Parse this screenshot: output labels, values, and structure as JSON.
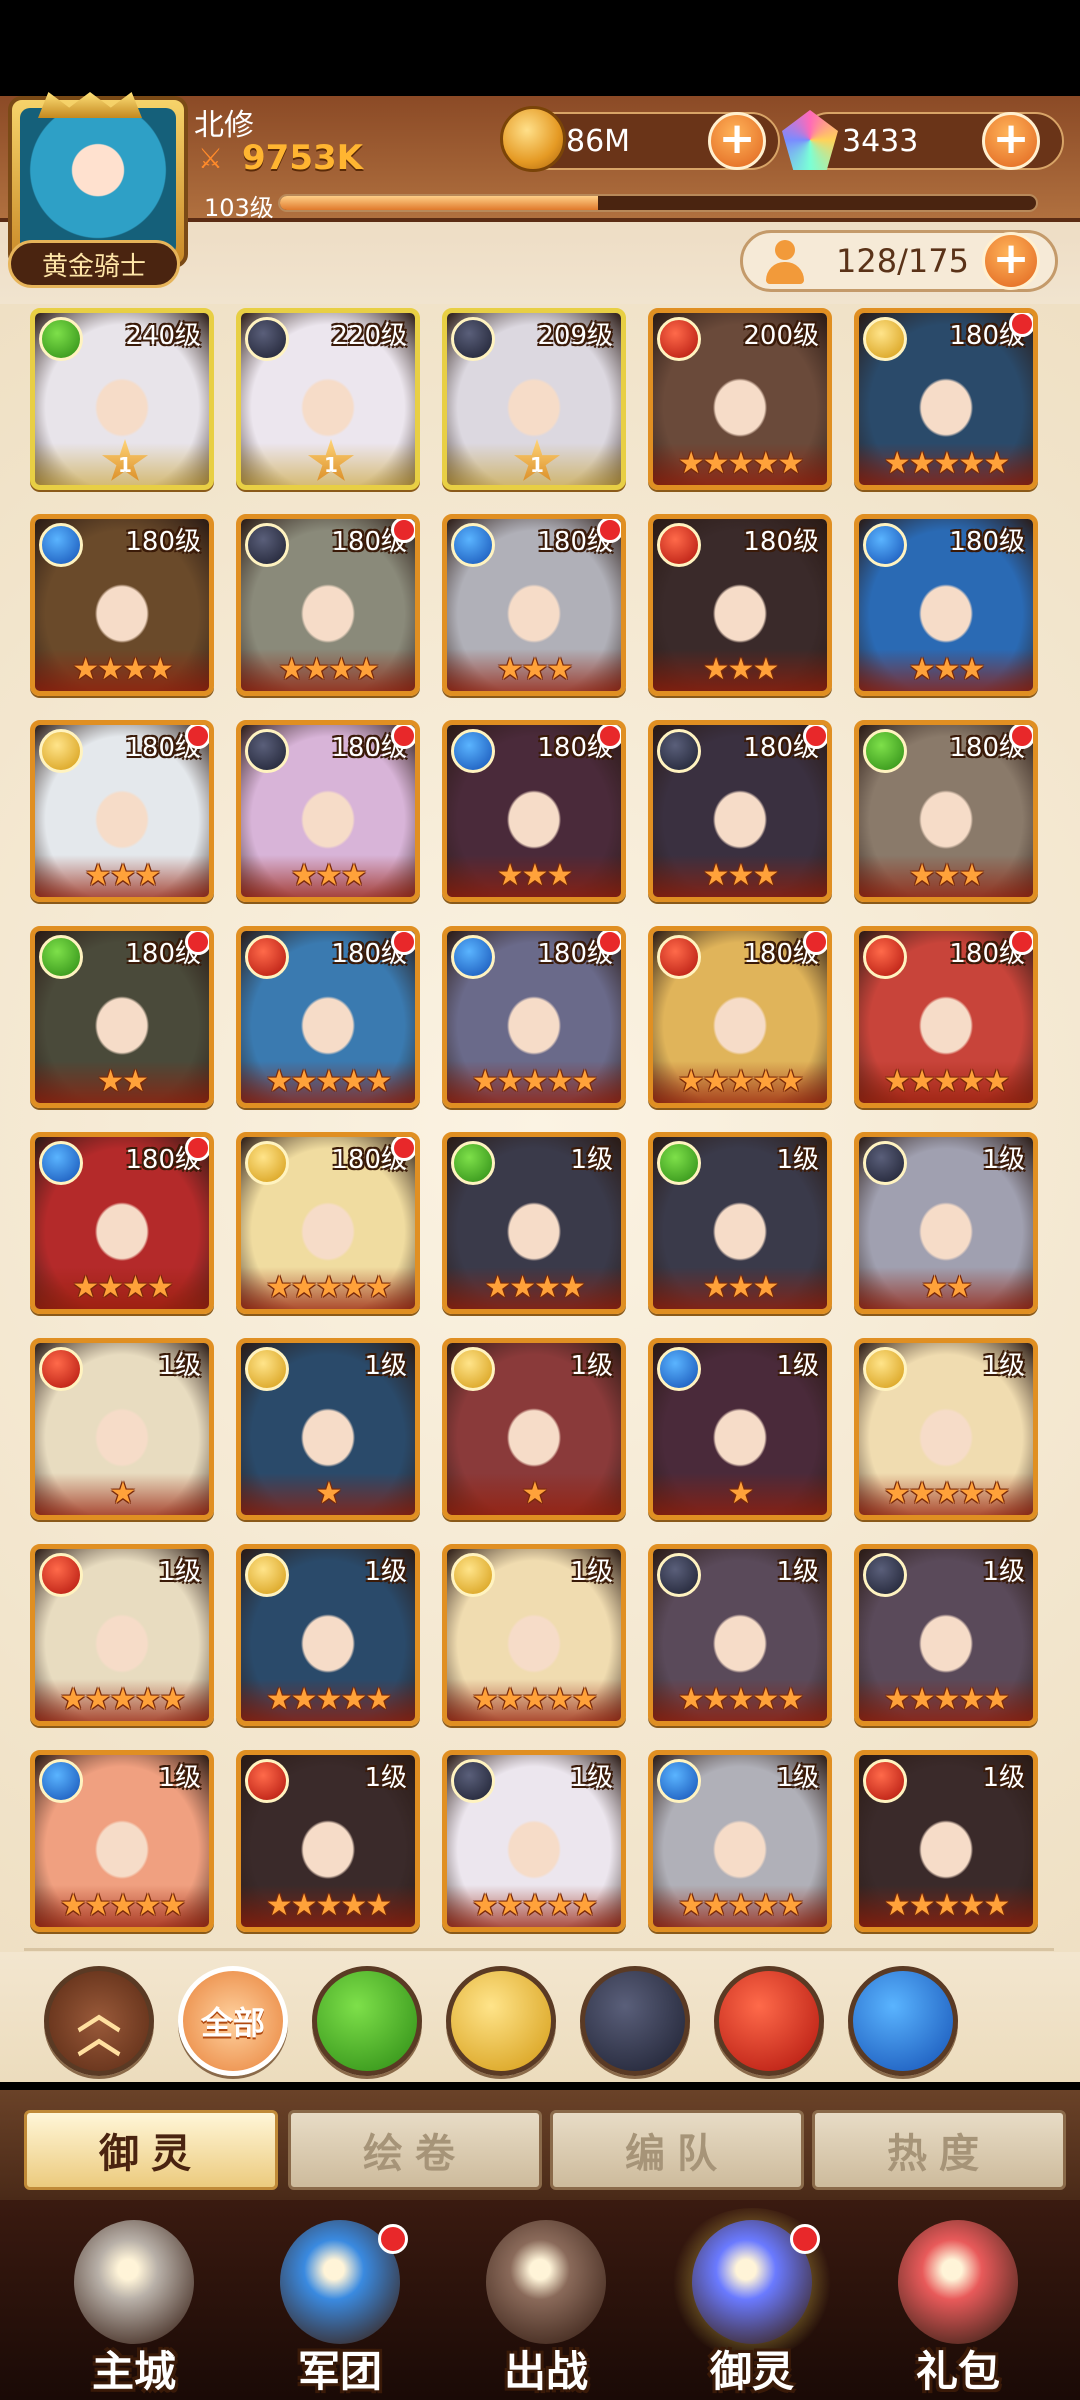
{
  "header": {
    "player_name": "北修",
    "power": "9753K",
    "level": "103级",
    "level_progress": 0.42,
    "rank": "黄金骑士",
    "gold": "86M",
    "gems": "3433",
    "roster": "128/175"
  },
  "heroes": [
    {
      "level": "240级",
      "element": "wind",
      "frame": "gold",
      "stars": "",
      "badge": "1",
      "dot": false,
      "tone": "#e8e4ea"
    },
    {
      "level": "220级",
      "element": "dark",
      "frame": "gold",
      "stars": "",
      "badge": "1",
      "dot": false,
      "tone": "#ece6ee"
    },
    {
      "level": "209级",
      "element": "dark",
      "frame": "gold",
      "stars": "",
      "badge": "1",
      "dot": false,
      "tone": "#dcd8e0"
    },
    {
      "level": "200级",
      "element": "fire",
      "frame": "orange",
      "stars": "★★★★★",
      "badge": "",
      "dot": false,
      "tone": "#6a4a3a"
    },
    {
      "level": "180级",
      "element": "light",
      "frame": "orange",
      "stars": "★★★★★",
      "badge": "",
      "dot": true,
      "tone": "#2a4a6a"
    },
    {
      "level": "180级",
      "element": "water",
      "frame": "orange",
      "stars": "★★★★",
      "badge": "",
      "dot": false,
      "tone": "#6a4a2a"
    },
    {
      "level": "180级",
      "element": "dark",
      "frame": "orange",
      "stars": "★★★★",
      "badge": "",
      "dot": true,
      "tone": "#8a8a7a"
    },
    {
      "level": "180级",
      "element": "water",
      "frame": "orange",
      "stars": "★★★",
      "badge": "",
      "dot": true,
      "tone": "#b0b0b8"
    },
    {
      "level": "180级",
      "element": "fire",
      "frame": "orange",
      "stars": "★★★",
      "badge": "",
      "dot": false,
      "tone": "#3a2a2a"
    },
    {
      "level": "180级",
      "element": "water",
      "frame": "orange",
      "stars": "★★★",
      "badge": "",
      "dot": false,
      "tone": "#2a6ab4"
    },
    {
      "level": "180级",
      "element": "light",
      "frame": "orange",
      "stars": "★★★",
      "badge": "",
      "dot": true,
      "tone": "#e4e8ec"
    },
    {
      "level": "180级",
      "element": "dark",
      "frame": "orange",
      "stars": "★★★",
      "badge": "",
      "dot": true,
      "tone": "#d8b4d8"
    },
    {
      "level": "180级",
      "element": "water",
      "frame": "orange",
      "stars": "★★★",
      "badge": "",
      "dot": true,
      "tone": "#4a2a3a"
    },
    {
      "level": "180级",
      "element": "dark",
      "frame": "orange",
      "stars": "★★★",
      "badge": "",
      "dot": true,
      "tone": "#3a3040"
    },
    {
      "level": "180级",
      "element": "wind",
      "frame": "orange",
      "stars": "★★★",
      "badge": "",
      "dot": true,
      "tone": "#8a7a6a"
    },
    {
      "level": "180级",
      "element": "wind",
      "frame": "orange",
      "stars": "★★",
      "badge": "",
      "dot": true,
      "tone": "#4a4a3a"
    },
    {
      "level": "180级",
      "element": "fire",
      "frame": "orange",
      "stars": "★★★★★",
      "badge": "",
      "dot": true,
      "tone": "#3a7ab0"
    },
    {
      "level": "180级",
      "element": "water",
      "frame": "orange",
      "stars": "★★★★★",
      "badge": "",
      "dot": true,
      "tone": "#6a6a8a"
    },
    {
      "level": "180级",
      "element": "fire",
      "frame": "orange",
      "stars": "★★★★★",
      "badge": "",
      "dot": true,
      "tone": "#e0b45a"
    },
    {
      "level": "180级",
      "element": "fire",
      "frame": "orange",
      "stars": "★★★★★",
      "badge": "",
      "dot": true,
      "tone": "#c8443a"
    },
    {
      "level": "180级",
      "element": "water",
      "frame": "orange",
      "stars": "★★★★",
      "badge": "",
      "dot": true,
      "tone": "#b42a2a"
    },
    {
      "level": "180级",
      "element": "light",
      "frame": "orange",
      "stars": "★★★★★",
      "badge": "",
      "dot": true,
      "tone": "#f0dca0"
    },
    {
      "level": "1级",
      "element": "wind",
      "frame": "orange",
      "stars": "★★★★",
      "badge": "",
      "dot": false,
      "tone": "#3a3a4a"
    },
    {
      "level": "1级",
      "element": "wind",
      "frame": "orange",
      "stars": "★★★",
      "badge": "",
      "dot": false,
      "tone": "#3a3a4a"
    },
    {
      "level": "1级",
      "element": "dark",
      "frame": "orange",
      "stars": "★★",
      "badge": "",
      "dot": false,
      "tone": "#a0a0b0"
    },
    {
      "level": "1级",
      "element": "fire",
      "frame": "orange",
      "stars": "★",
      "badge": "",
      "dot": false,
      "tone": "#e8dcc0"
    },
    {
      "level": "1级",
      "element": "light",
      "frame": "orange",
      "stars": "★",
      "badge": "",
      "dot": false,
      "tone": "#2a4a6a"
    },
    {
      "level": "1级",
      "element": "light",
      "frame": "orange",
      "stars": "★",
      "badge": "",
      "dot": false,
      "tone": "#8a3a3a"
    },
    {
      "level": "1级",
      "element": "water",
      "frame": "orange",
      "stars": "★",
      "badge": "",
      "dot": false,
      "tone": "#4a2a3a"
    },
    {
      "level": "1级",
      "element": "light",
      "frame": "orange",
      "stars": "★★★★★",
      "badge": "",
      "dot": false,
      "tone": "#f0dcb0"
    },
    {
      "level": "1级",
      "element": "fire",
      "frame": "orange",
      "stars": "★★★★★",
      "badge": "",
      "dot": false,
      "tone": "#e8dcc0"
    },
    {
      "level": "1级",
      "element": "light",
      "frame": "orange",
      "stars": "★★★★★",
      "badge": "",
      "dot": false,
      "tone": "#2a4a6a"
    },
    {
      "level": "1级",
      "element": "light",
      "frame": "orange",
      "stars": "★★★★★",
      "badge": "",
      "dot": false,
      "tone": "#f0dcb0"
    },
    {
      "level": "1级",
      "element": "dark",
      "frame": "orange",
      "stars": "★★★★★",
      "badge": "",
      "dot": false,
      "tone": "#5a4a5a"
    },
    {
      "level": "1级",
      "element": "dark",
      "frame": "orange",
      "stars": "★★★★★",
      "badge": "",
      "dot": false,
      "tone": "#5a4a5a"
    },
    {
      "level": "1级",
      "element": "water",
      "frame": "orange",
      "stars": "★★★★★",
      "badge": "",
      "dot": false,
      "tone": "#f0a080"
    },
    {
      "level": "1级",
      "element": "fire",
      "frame": "orange",
      "stars": "★★★★★",
      "badge": "",
      "dot": false,
      "tone": "#3a2a2a"
    },
    {
      "level": "1级",
      "element": "dark",
      "frame": "orange",
      "stars": "★★★★★",
      "badge": "",
      "dot": false,
      "tone": "#ece6ee"
    },
    {
      "level": "1级",
      "element": "water",
      "frame": "orange",
      "stars": "★★★★★",
      "badge": "",
      "dot": false,
      "tone": "#b0b0b8"
    },
    {
      "level": "1级",
      "element": "fire",
      "frame": "orange",
      "stars": "★★★★★",
      "badge": "",
      "dot": false,
      "tone": "#3a2a2a"
    }
  ],
  "filters": {
    "all_label": "全部",
    "elements": [
      "wind",
      "light",
      "dark",
      "fire",
      "water"
    ]
  },
  "tabs": [
    {
      "label": "御灵",
      "active": true
    },
    {
      "label": "绘卷",
      "active": false
    },
    {
      "label": "编队",
      "active": false
    },
    {
      "label": "热度",
      "active": false
    }
  ],
  "nav": [
    {
      "label": "主城",
      "icon": "castle-icon",
      "dot": false,
      "active": false
    },
    {
      "label": "军团",
      "icon": "fist-shield-icon",
      "dot": true,
      "active": false
    },
    {
      "label": "出战",
      "icon": "gate-icon",
      "dot": false,
      "active": false
    },
    {
      "label": "御灵",
      "icon": "crystal-icon",
      "dot": true,
      "active": true
    },
    {
      "label": "礼包",
      "icon": "shop-icon",
      "dot": false,
      "active": false
    }
  ],
  "colors": {
    "frame_orange": "#e08f22",
    "frame_gold": "#e8cf44",
    "accent": "#e0641e",
    "badge_red": "#e8282a"
  }
}
